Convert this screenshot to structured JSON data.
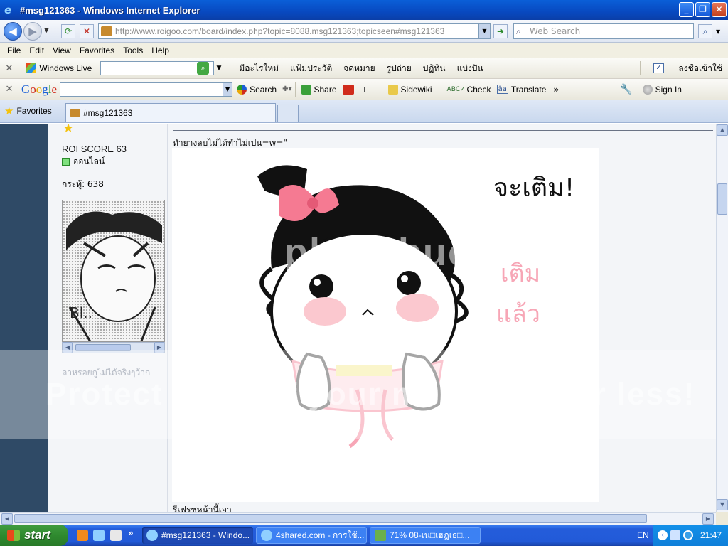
{
  "window": {
    "title": "#msg121363 - Windows Internet Explorer",
    "minimize": "_",
    "maximize": "❐",
    "close": "✕"
  },
  "address_bar": {
    "url": "http://www.roigoo.com/board/index.php?topic=8088.msg121363;topicseen#msg121363",
    "search_placeholder": "Web Search"
  },
  "menu": [
    "File",
    "Edit",
    "View",
    "Favorites",
    "Tools",
    "Help"
  ],
  "live_toolbar": {
    "brand": "Windows Live",
    "links": [
      "มีอะไรใหม่",
      "แฟ้มประวัติ",
      "จดหมาย",
      "รูปถ่าย",
      "ปฏิทิน",
      "แบ่งปัน"
    ],
    "signin": "ลงชื่อเข้าใช้"
  },
  "google_toolbar": {
    "brand": "Google",
    "search": "Search",
    "share": "Share",
    "sidewiki": "Sidewiki",
    "check": "Check",
    "translate": "Translate",
    "signin": "Sign In"
  },
  "tabs": {
    "favorites": "Favorites",
    "active_tab": "#msg121363"
  },
  "post": {
    "score": "ROI SCORE 63",
    "online": "ออนไลน์",
    "posts": "กระทู้: 638",
    "signature": "ลาหรอยกูไม่ได้จริงๆว้าก",
    "title": "ทำยางลบไม่ได้ทำไม่เปน=w=\"",
    "tail": "รีเฟรชหน้านี้เอา",
    "drawing_text_1": "จะเติม!",
    "drawing_text_2": "เติม",
    "drawing_text_3": "แล้ว",
    "watermark_1": "photobucket",
    "watermark_2": "Protect more of your memories for less!"
  },
  "taskbar": {
    "start": "start",
    "items": [
      {
        "label": "#msg121363 - Windo...",
        "active": true
      },
      {
        "label": "4shared.com - การใช้...",
        "active": false
      },
      {
        "label": "71% 08-เน□เฮฎเธ□...",
        "active": false
      }
    ],
    "language": "EN",
    "clock": "21:47"
  },
  "colors": {
    "title_blue": "#0849c0",
    "taskbar_blue": "#245ddb",
    "start_green": "#2f8a2f",
    "sidebar_dark": "#2f4a66",
    "pink": "#f57a92"
  }
}
